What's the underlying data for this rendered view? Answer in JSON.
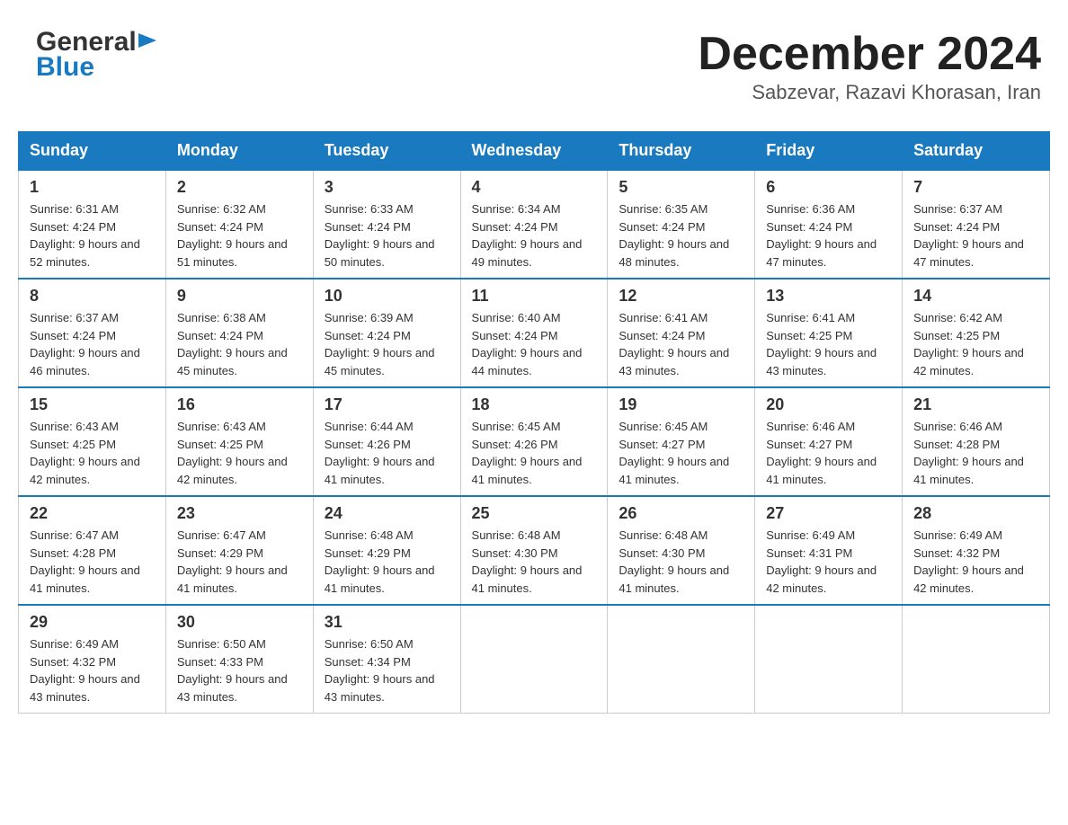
{
  "header": {
    "logo_text": "General",
    "logo_blue": "Blue",
    "month_title": "December 2024",
    "location": "Sabzevar, Razavi Khorasan, Iran"
  },
  "days_of_week": [
    "Sunday",
    "Monday",
    "Tuesday",
    "Wednesday",
    "Thursday",
    "Friday",
    "Saturday"
  ],
  "weeks": [
    [
      {
        "day": "1",
        "sunrise": "6:31 AM",
        "sunset": "4:24 PM",
        "daylight": "9 hours and 52 minutes."
      },
      {
        "day": "2",
        "sunrise": "6:32 AM",
        "sunset": "4:24 PM",
        "daylight": "9 hours and 51 minutes."
      },
      {
        "day": "3",
        "sunrise": "6:33 AM",
        "sunset": "4:24 PM",
        "daylight": "9 hours and 50 minutes."
      },
      {
        "day": "4",
        "sunrise": "6:34 AM",
        "sunset": "4:24 PM",
        "daylight": "9 hours and 49 minutes."
      },
      {
        "day": "5",
        "sunrise": "6:35 AM",
        "sunset": "4:24 PM",
        "daylight": "9 hours and 48 minutes."
      },
      {
        "day": "6",
        "sunrise": "6:36 AM",
        "sunset": "4:24 PM",
        "daylight": "9 hours and 47 minutes."
      },
      {
        "day": "7",
        "sunrise": "6:37 AM",
        "sunset": "4:24 PM",
        "daylight": "9 hours and 47 minutes."
      }
    ],
    [
      {
        "day": "8",
        "sunrise": "6:37 AM",
        "sunset": "4:24 PM",
        "daylight": "9 hours and 46 minutes."
      },
      {
        "day": "9",
        "sunrise": "6:38 AM",
        "sunset": "4:24 PM",
        "daylight": "9 hours and 45 minutes."
      },
      {
        "day": "10",
        "sunrise": "6:39 AM",
        "sunset": "4:24 PM",
        "daylight": "9 hours and 45 minutes."
      },
      {
        "day": "11",
        "sunrise": "6:40 AM",
        "sunset": "4:24 PM",
        "daylight": "9 hours and 44 minutes."
      },
      {
        "day": "12",
        "sunrise": "6:41 AM",
        "sunset": "4:24 PM",
        "daylight": "9 hours and 43 minutes."
      },
      {
        "day": "13",
        "sunrise": "6:41 AM",
        "sunset": "4:25 PM",
        "daylight": "9 hours and 43 minutes."
      },
      {
        "day": "14",
        "sunrise": "6:42 AM",
        "sunset": "4:25 PM",
        "daylight": "9 hours and 42 minutes."
      }
    ],
    [
      {
        "day": "15",
        "sunrise": "6:43 AM",
        "sunset": "4:25 PM",
        "daylight": "9 hours and 42 minutes."
      },
      {
        "day": "16",
        "sunrise": "6:43 AM",
        "sunset": "4:25 PM",
        "daylight": "9 hours and 42 minutes."
      },
      {
        "day": "17",
        "sunrise": "6:44 AM",
        "sunset": "4:26 PM",
        "daylight": "9 hours and 41 minutes."
      },
      {
        "day": "18",
        "sunrise": "6:45 AM",
        "sunset": "4:26 PM",
        "daylight": "9 hours and 41 minutes."
      },
      {
        "day": "19",
        "sunrise": "6:45 AM",
        "sunset": "4:27 PM",
        "daylight": "9 hours and 41 minutes."
      },
      {
        "day": "20",
        "sunrise": "6:46 AM",
        "sunset": "4:27 PM",
        "daylight": "9 hours and 41 minutes."
      },
      {
        "day": "21",
        "sunrise": "6:46 AM",
        "sunset": "4:28 PM",
        "daylight": "9 hours and 41 minutes."
      }
    ],
    [
      {
        "day": "22",
        "sunrise": "6:47 AM",
        "sunset": "4:28 PM",
        "daylight": "9 hours and 41 minutes."
      },
      {
        "day": "23",
        "sunrise": "6:47 AM",
        "sunset": "4:29 PM",
        "daylight": "9 hours and 41 minutes."
      },
      {
        "day": "24",
        "sunrise": "6:48 AM",
        "sunset": "4:29 PM",
        "daylight": "9 hours and 41 minutes."
      },
      {
        "day": "25",
        "sunrise": "6:48 AM",
        "sunset": "4:30 PM",
        "daylight": "9 hours and 41 minutes."
      },
      {
        "day": "26",
        "sunrise": "6:48 AM",
        "sunset": "4:30 PM",
        "daylight": "9 hours and 41 minutes."
      },
      {
        "day": "27",
        "sunrise": "6:49 AM",
        "sunset": "4:31 PM",
        "daylight": "9 hours and 42 minutes."
      },
      {
        "day": "28",
        "sunrise": "6:49 AM",
        "sunset": "4:32 PM",
        "daylight": "9 hours and 42 minutes."
      }
    ],
    [
      {
        "day": "29",
        "sunrise": "6:49 AM",
        "sunset": "4:32 PM",
        "daylight": "9 hours and 43 minutes."
      },
      {
        "day": "30",
        "sunrise": "6:50 AM",
        "sunset": "4:33 PM",
        "daylight": "9 hours and 43 minutes."
      },
      {
        "day": "31",
        "sunrise": "6:50 AM",
        "sunset": "4:34 PM",
        "daylight": "9 hours and 43 minutes."
      },
      null,
      null,
      null,
      null
    ]
  ]
}
